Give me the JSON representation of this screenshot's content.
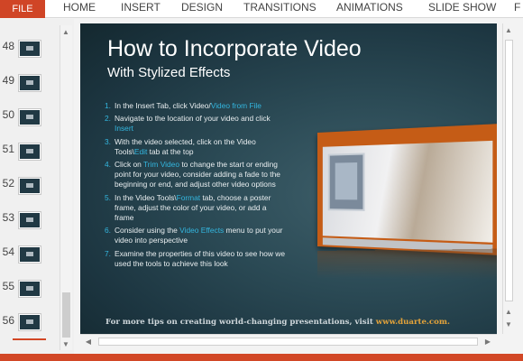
{
  "ribbon": {
    "file_label": "FILE",
    "tabs": [
      "HOME",
      "INSERT",
      "DESIGN",
      "TRANSITIONS",
      "ANIMATIONS",
      "SLIDE SHOW",
      "F"
    ]
  },
  "thumbnails": {
    "numbers": [
      "48",
      "49",
      "50",
      "51",
      "52",
      "53",
      "54",
      "55",
      "56"
    ]
  },
  "slide": {
    "title": "How to Incorporate Video",
    "subtitle": "With Stylized Effects",
    "steps": [
      {
        "num": "1.",
        "t1": "In the Insert Tab, click Video/",
        "h1": "Video from File",
        "t2": ""
      },
      {
        "num": "2.",
        "t1": "Navigate to the location of your video and click ",
        "h1": "Insert",
        "t2": ""
      },
      {
        "num": "3.",
        "t1": "With the video selected, click on the Video Tools\\",
        "h1": "Edit",
        "t2": " tab at the top"
      },
      {
        "num": "4.",
        "t1": "Click on ",
        "h1": "Trim Video",
        "t2": " to change the start or ending point for your video, consider adding a fade to the beginning or end, and adjust other video options"
      },
      {
        "num": "5.",
        "t1": "In the Video Tools\\",
        "h1": "Format",
        "t2": " tab, choose a poster frame, adjust the color of your video, or add a frame"
      },
      {
        "num": "6.",
        "t1": "Consider using the ",
        "h1": "Video Effects",
        "t2": " menu to put your video into perspective"
      },
      {
        "num": "7.",
        "t1": "Examine the properties of this video to see how we used the tools to achieve this look",
        "h1": "",
        "t2": ""
      }
    ],
    "footer_text": "For more tips on creating world-changing presentations, visit ",
    "footer_url": "www.duarte.com."
  },
  "colors": {
    "accent": "#d24726",
    "highlight": "#33b6df",
    "footer_url": "#e4a33a"
  }
}
